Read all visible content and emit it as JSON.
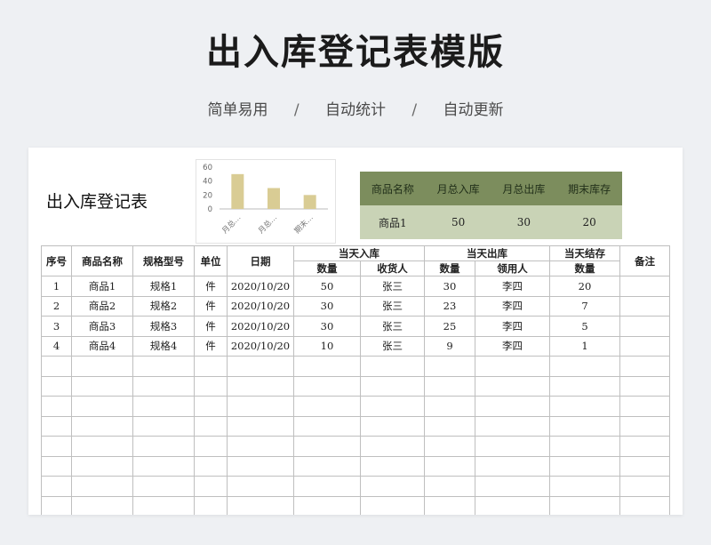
{
  "header": {
    "title": "出入库登记表模版",
    "features": [
      "简单易用",
      "自动统计",
      "自动更新"
    ],
    "separator": "/"
  },
  "sheet": {
    "title": "出入库登记表"
  },
  "chart_data": {
    "type": "bar",
    "categories": [
      "月总…",
      "月总…",
      "期末…"
    ],
    "values": [
      50,
      30,
      20
    ],
    "ylim": [
      0,
      60
    ],
    "yticks": [
      0,
      20,
      40,
      60
    ],
    "bar_color": "#d9cc94",
    "grid": false,
    "legend": "none"
  },
  "summary": {
    "headers": [
      "商品名称",
      "月总入库",
      "月总出库",
      "期末库存"
    ],
    "row": [
      "商品1",
      "50",
      "30",
      "20"
    ],
    "header_bg": "#7c8d5d",
    "row_bg": "#c9d3b6"
  },
  "table": {
    "headers": {
      "index": "序号",
      "name": "商品名称",
      "model": "规格型号",
      "unit": "单位",
      "date": "日期",
      "in_group": "当天入库",
      "out_group": "当天出库",
      "stock_group": "当天结存",
      "remark": "备注",
      "qty": "数量",
      "receiver": "收货人",
      "collector": "领用人"
    },
    "rows": [
      [
        "1",
        "商品1",
        "规格1",
        "件",
        "2020/10/20",
        "50",
        "张三",
        "30",
        "李四",
        "20",
        ""
      ],
      [
        "2",
        "商品2",
        "规格2",
        "件",
        "2020/10/20",
        "30",
        "张三",
        "23",
        "李四",
        "7",
        ""
      ],
      [
        "3",
        "商品3",
        "规格3",
        "件",
        "2020/10/20",
        "30",
        "张三",
        "25",
        "李四",
        "5",
        ""
      ],
      [
        "4",
        "商品4",
        "规格4",
        "件",
        "2020/10/20",
        "10",
        "张三",
        "9",
        "李四",
        "1",
        ""
      ],
      [
        "",
        "",
        "",
        "",
        "",
        "",
        "",
        "",
        "",
        "",
        ""
      ],
      [
        "",
        "",
        "",
        "",
        "",
        "",
        "",
        "",
        "",
        "",
        ""
      ],
      [
        "",
        "",
        "",
        "",
        "",
        "",
        "",
        "",
        "",
        "",
        ""
      ],
      [
        "",
        "",
        "",
        "",
        "",
        "",
        "",
        "",
        "",
        "",
        ""
      ],
      [
        "",
        "",
        "",
        "",
        "",
        "",
        "",
        "",
        "",
        "",
        ""
      ],
      [
        "",
        "",
        "",
        "",
        "",
        "",
        "",
        "",
        "",
        "",
        ""
      ],
      [
        "",
        "",
        "",
        "",
        "",
        "",
        "",
        "",
        "",
        "",
        ""
      ],
      [
        "",
        "",
        "",
        "",
        "",
        "",
        "",
        "",
        "",
        "",
        ""
      ]
    ]
  }
}
